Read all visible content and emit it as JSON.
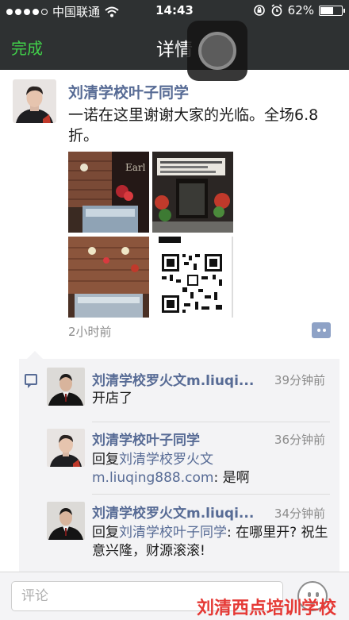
{
  "status_bar": {
    "carrier": "中国联通",
    "time": "14:43",
    "battery": "62%",
    "battery_level": 0.62
  },
  "nav": {
    "done_label": "完成",
    "title": "详情"
  },
  "post": {
    "author": "刘清学校叶子同学",
    "text": "一诺在这里谢谢大家的光临。全场6.8折。",
    "time": "2小时前"
  },
  "comments": [
    {
      "author": "刘清学校罗火文m.liuqi...",
      "time": "39分钟前",
      "text": "开店了"
    },
    {
      "author": "刘清学校叶子同学",
      "time": "36分钟前",
      "reply_prefix": "回复",
      "reply_to": "刘清学校罗火文m.liuqing888.com",
      "text": ": 是啊"
    },
    {
      "author": "刘清学校罗火文m.liuqi...",
      "time": "34分钟前",
      "reply_prefix": "回复",
      "reply_to": "刘清学校叶子同学",
      "text": ": 在哪里开? 祝生意兴隆，财源滚滚!"
    }
  ],
  "input": {
    "placeholder": "评论"
  },
  "watermark": "刘清西点培训学校",
  "colors": {
    "nav_bg": "#2e3132",
    "accent_green": "#41d14a",
    "link_blue": "#576b95",
    "watermark_red": "#e53935"
  }
}
